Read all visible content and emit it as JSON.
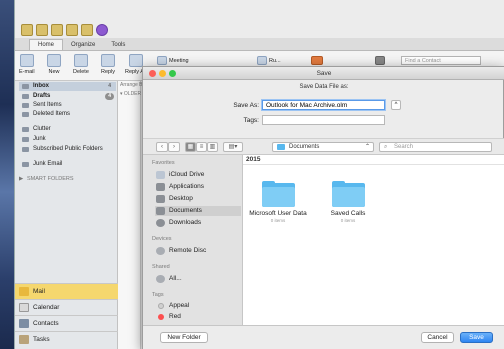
{
  "outlook": {
    "tabs": [
      "Home",
      "Organize",
      "Tools"
    ],
    "ribbon": {
      "email": "E-mail",
      "new": "New",
      "delete": "Delete",
      "reply": "Reply",
      "reply_all": "Reply All",
      "meeting": "Meeting",
      "rules": "Ru...",
      "find_contact_placeholder": "Find a Contact"
    },
    "folders": [
      {
        "name": "Inbox",
        "badge": "4",
        "bold": true,
        "selected": true
      },
      {
        "name": "Drafts",
        "badge": "4",
        "bold": true
      },
      {
        "name": "Sent Items"
      },
      {
        "name": "Deleted Items"
      },
      {
        "name": "Clutter"
      },
      {
        "name": "Junk"
      },
      {
        "name": "Subscribed Public Folders"
      },
      {
        "name": "Junk Email"
      }
    ],
    "smart_folders": "SMART FOLDERS",
    "arrange": "Arrange B",
    "older": "OLDER",
    "nav": [
      "Mail",
      "Calendar",
      "Contacts",
      "Tasks"
    ]
  },
  "dialog": {
    "window_title": "Save",
    "header": "Save Data File as:",
    "save_as_label": "Save As:",
    "save_as_value": "Outlook for Mac Archive.olm",
    "tags_label": "Tags:",
    "location": "Documents",
    "search_placeholder": "Search",
    "sidebar": {
      "favorites_heading": "Favorites",
      "favorites": [
        "iCloud Drive",
        "Applications",
        "Desktop",
        "Documents",
        "Downloads"
      ],
      "devices_heading": "Devices",
      "devices": [
        "Remote Disc"
      ],
      "shared_heading": "Shared",
      "shared": [
        "All..."
      ],
      "tags_heading": "Tags",
      "tags": [
        "Appeal",
        "Red"
      ]
    },
    "section": "2015",
    "files": [
      {
        "name": "Microsoft User Data",
        "sub": "0 items"
      },
      {
        "name": "Saved Calls",
        "sub": "0 items"
      }
    ],
    "new_folder": "New Folder",
    "cancel": "Cancel",
    "save": "Save"
  },
  "colors": {
    "accent": "#2f86f2",
    "folder": "#58b8ee",
    "nav_selected": "#f5d76e"
  }
}
